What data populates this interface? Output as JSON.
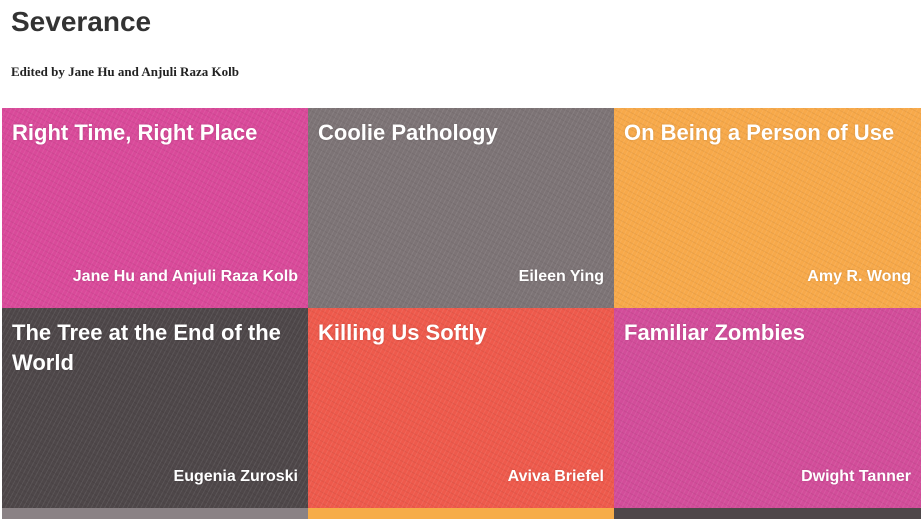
{
  "page": {
    "title": "Severance",
    "subtitle": "Edited by Jane Hu and Anjuli Raza Kolb"
  },
  "tiles": [
    {
      "title": "Right Time, Right Place",
      "author": "Jane Hu and Anjuli Raza Kolb",
      "color": "#d94a9a"
    },
    {
      "title": "Coolie Pathology",
      "author": "Eileen Ying",
      "color": "#7d7476"
    },
    {
      "title": "On Being a Person of Use",
      "author": "Amy R. Wong",
      "color": "#f7a94a"
    },
    {
      "title": "The Tree at the End of the World",
      "author": "Eugenia Zuroski",
      "color": "#4e4749"
    },
    {
      "title": "Killing Us Softly",
      "author": "Aviva Briefel",
      "color": "#ee5a4c"
    },
    {
      "title": "Familiar Zombies",
      "author": "Dwight Tanner",
      "color": "#d24d9a"
    }
  ],
  "partial_tiles": [
    {
      "color": "#8a8285"
    },
    {
      "color": "#f6ac48"
    },
    {
      "color": "#4e4749"
    }
  ]
}
